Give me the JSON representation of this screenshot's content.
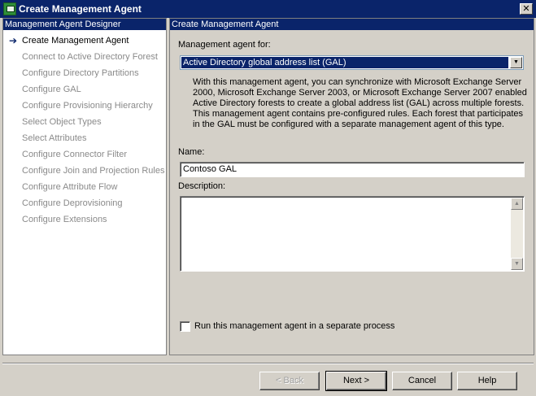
{
  "window": {
    "title": "Create Management Agent",
    "close_glyph": "✕"
  },
  "left_panel": {
    "header": "Management Agent Designer",
    "active_marker": "➔",
    "items": [
      {
        "label": "Create Management Agent"
      },
      {
        "label": "Connect to Active Directory Forest"
      },
      {
        "label": "Configure Directory Partitions"
      },
      {
        "label": "Configure GAL"
      },
      {
        "label": "Configure Provisioning Hierarchy"
      },
      {
        "label": "Select Object Types"
      },
      {
        "label": "Select Attributes"
      },
      {
        "label": "Configure Connector Filter"
      },
      {
        "label": "Configure Join and Projection Rules"
      },
      {
        "label": "Configure Attribute Flow"
      },
      {
        "label": "Configure Deprovisioning"
      },
      {
        "label": "Configure Extensions"
      }
    ]
  },
  "right_panel": {
    "header": "Create Management Agent",
    "agent_for_label": "Management agent for:",
    "agent_for_value": "Active Directory global address list (GAL)",
    "description": "With this management agent, you can synchronize with Microsoft Exchange Server 2000, Microsoft Exchange Server 2003, or Microsoft Exchange Server 2007 enabled Active Directory forests to create a global address list (GAL) across multiple forests. This management agent contains pre-configured rules. Each forest that participates in the GAL must be configured with a separate management agent of this type.",
    "name_label": "Name:",
    "name_value": "Contoso GAL",
    "description_label": "Description:",
    "description_value": "",
    "separate_process_label": "Run this management agent in a separate process"
  },
  "buttons": {
    "back": "< Back",
    "next": "Next >",
    "cancel": "Cancel",
    "help": "Help"
  },
  "icons": {
    "dropdown": "▼",
    "scroll_up": "▲",
    "scroll_down": "▼"
  },
  "colors": {
    "titlebar": "#0a246a",
    "dialog_bg": "#d4d0c8",
    "disabled_text": "#8a8a8a"
  }
}
